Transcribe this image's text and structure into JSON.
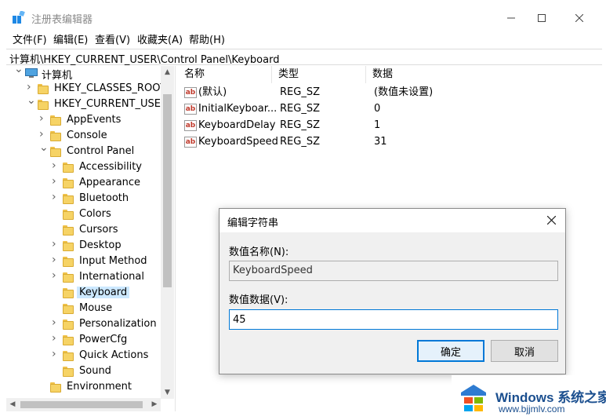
{
  "window": {
    "title": "注册表编辑器",
    "min_icon": "minimize-icon",
    "max_icon": "maximize-icon",
    "close_icon": "close-icon"
  },
  "menu": [
    "文件(F)",
    "编辑(E)",
    "查看(V)",
    "收藏夹(A)",
    "帮助(H)"
  ],
  "address": "计算机\\HKEY_CURRENT_USER\\Control Panel\\Keyboard",
  "tree": [
    {
      "label": "计算机",
      "level": 0,
      "expander": "expanded",
      "icon": "computer-icon"
    },
    {
      "label": "HKEY_CLASSES_ROOT",
      "level": 1,
      "expander": "collapsed",
      "icon": "folder-icon"
    },
    {
      "label": "HKEY_CURRENT_USER",
      "level": 1,
      "expander": "expanded",
      "icon": "folder-icon"
    },
    {
      "label": "AppEvents",
      "level": 2,
      "expander": "collapsed",
      "icon": "folder-icon"
    },
    {
      "label": "Console",
      "level": 2,
      "expander": "collapsed",
      "icon": "folder-icon"
    },
    {
      "label": "Control Panel",
      "level": 2,
      "expander": "expanded",
      "icon": "folder-icon"
    },
    {
      "label": "Accessibility",
      "level": 3,
      "expander": "collapsed",
      "icon": "folder-icon"
    },
    {
      "label": "Appearance",
      "level": 3,
      "expander": "collapsed",
      "icon": "folder-icon"
    },
    {
      "label": "Bluetooth",
      "level": 3,
      "expander": "collapsed",
      "icon": "folder-icon"
    },
    {
      "label": "Colors",
      "level": 3,
      "expander": "none",
      "icon": "folder-icon"
    },
    {
      "label": "Cursors",
      "level": 3,
      "expander": "none",
      "icon": "folder-icon"
    },
    {
      "label": "Desktop",
      "level": 3,
      "expander": "collapsed",
      "icon": "folder-icon"
    },
    {
      "label": "Input Method",
      "level": 3,
      "expander": "collapsed",
      "icon": "folder-icon"
    },
    {
      "label": "International",
      "level": 3,
      "expander": "collapsed",
      "icon": "folder-icon"
    },
    {
      "label": "Keyboard",
      "level": 3,
      "expander": "none",
      "icon": "folder-icon",
      "selected": true
    },
    {
      "label": "Mouse",
      "level": 3,
      "expander": "none",
      "icon": "folder-icon"
    },
    {
      "label": "Personalization",
      "level": 3,
      "expander": "collapsed",
      "icon": "folder-icon"
    },
    {
      "label": "PowerCfg",
      "level": 3,
      "expander": "collapsed",
      "icon": "folder-icon"
    },
    {
      "label": "Quick Actions",
      "level": 3,
      "expander": "collapsed",
      "icon": "folder-icon"
    },
    {
      "label": "Sound",
      "level": 3,
      "expander": "none",
      "icon": "folder-icon"
    },
    {
      "label": "Environment",
      "level": 2,
      "expander": "none",
      "icon": "folder-icon"
    }
  ],
  "list": {
    "headers": [
      "名称",
      "类型",
      "数据"
    ],
    "rows": [
      {
        "name": "(默认)",
        "type": "REG_SZ",
        "data": "(数值未设置)"
      },
      {
        "name": "InitialKeyboar...",
        "type": "REG_SZ",
        "data": "0"
      },
      {
        "name": "KeyboardDelay",
        "type": "REG_SZ",
        "data": "1"
      },
      {
        "name": "KeyboardSpeed",
        "type": "REG_SZ",
        "data": "31"
      }
    ],
    "row_icon_text": "ab"
  },
  "dialog": {
    "title": "编辑字符串",
    "name_label": "数值名称(N):",
    "name_value": "KeyboardSpeed",
    "data_label": "数值数据(V):",
    "data_value": "45",
    "ok_label": "确定",
    "cancel_label": "取消"
  },
  "watermark": {
    "brand": "Windows",
    "brand_cn": "系统之家",
    "url": "www.bjjmlv.com"
  },
  "colors": {
    "accent": "#0078d7",
    "selection": "#cce8ff",
    "folder": "#f6d365",
    "brand": "#1b4f8f"
  }
}
